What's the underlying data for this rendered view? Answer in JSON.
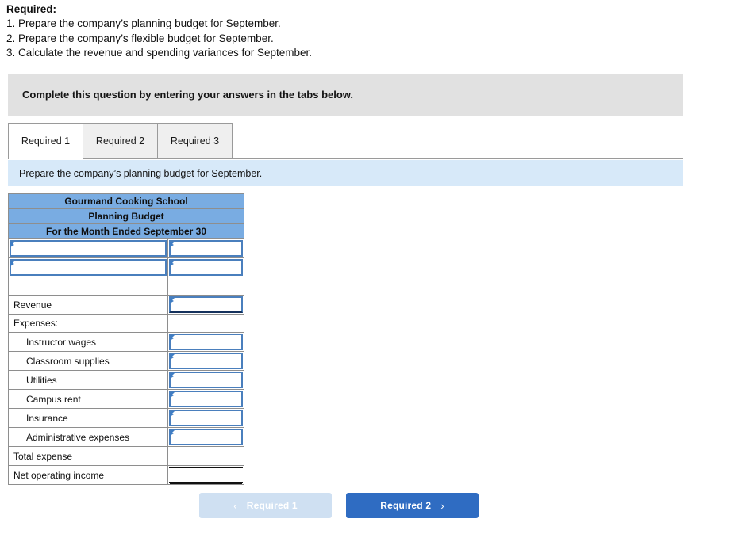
{
  "required": {
    "title": "Required:",
    "items": [
      "1. Prepare the company’s planning budget for September.",
      "2. Prepare the company’s flexible budget for September.",
      "3. Calculate the revenue and spending variances for September."
    ]
  },
  "instruction_banner": {
    "text": "Complete this question by entering your answers in the tabs below."
  },
  "tabs": [
    {
      "label": "Required 1",
      "active": true
    },
    {
      "label": "Required 2",
      "active": false
    },
    {
      "label": "Required 3",
      "active": false
    }
  ],
  "sub_instruction": {
    "text": "Prepare the company’s planning budget for September."
  },
  "table": {
    "headers": [
      "Gourmand Cooking School",
      "Planning Budget",
      "For the Month Ended September 30"
    ],
    "rows": [
      {
        "label": "",
        "label_kind": "input",
        "value": "",
        "value_kind": "input",
        "indent": false
      },
      {
        "label": "",
        "label_kind": "input",
        "value": "",
        "value_kind": "input",
        "indent": false
      },
      {
        "label": "",
        "label_kind": "blank",
        "value": "",
        "value_kind": "blank",
        "indent": false
      },
      {
        "label": "Revenue",
        "label_kind": "text",
        "value": "",
        "value_kind": "input-underline",
        "indent": false
      },
      {
        "label": "Expenses:",
        "label_kind": "text",
        "value": "",
        "value_kind": "blank",
        "indent": false
      },
      {
        "label": "Instructor wages",
        "label_kind": "text",
        "value": "",
        "value_kind": "input",
        "indent": true
      },
      {
        "label": "Classroom supplies",
        "label_kind": "text",
        "value": "",
        "value_kind": "input",
        "indent": true
      },
      {
        "label": "Utilities",
        "label_kind": "text",
        "value": "",
        "value_kind": "input",
        "indent": true
      },
      {
        "label": "Campus rent",
        "label_kind": "text",
        "value": "",
        "value_kind": "input",
        "indent": true
      },
      {
        "label": "Insurance",
        "label_kind": "text",
        "value": "",
        "value_kind": "input",
        "indent": true
      },
      {
        "label": "Administrative expenses",
        "label_kind": "text",
        "value": "",
        "value_kind": "input",
        "indent": true
      },
      {
        "label": "Total expense",
        "label_kind": "text",
        "value": "",
        "value_kind": "total",
        "indent": false
      },
      {
        "label": "Net operating income",
        "label_kind": "text",
        "value": "",
        "value_kind": "grand-total",
        "indent": false
      }
    ]
  },
  "nav": {
    "prev_label": "Required 1",
    "next_label": "Required 2",
    "prev_icon": "chevron-left-icon",
    "next_icon": "chevron-right-icon",
    "prev_chevron": "‹",
    "next_chevron": "›",
    "prev_disabled": true
  },
  "colors": {
    "table_header_blue": "#79ace2",
    "sub_instruction_blue": "#d7e9f9",
    "instruction_gray": "#e1e1e1",
    "input_border_blue": "#4a7fbd",
    "marker_blue": "#3f7dc4",
    "nav_active_blue": "#2f6cc2",
    "nav_disabled_blue": "#cfe0f2",
    "rule_dark": "#14315c"
  }
}
